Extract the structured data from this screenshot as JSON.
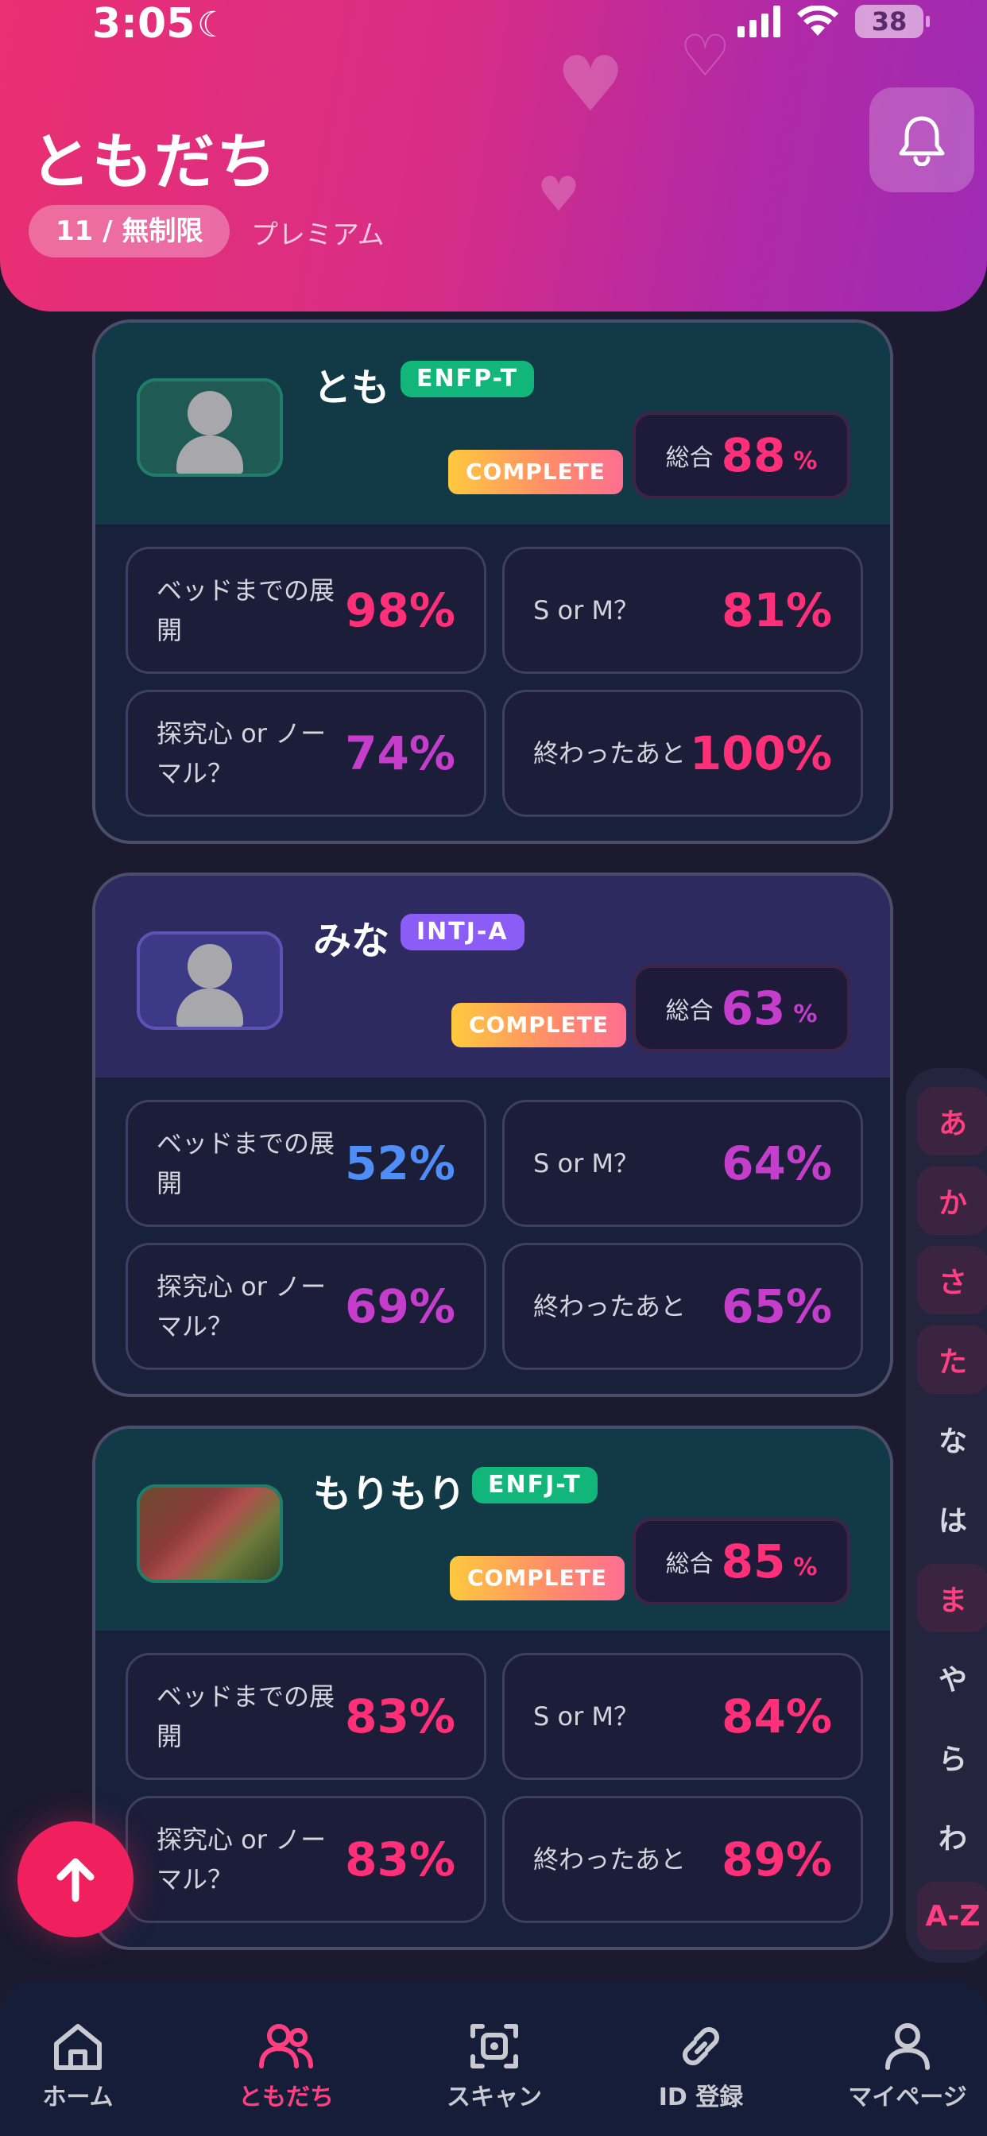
{
  "status_bar": {
    "time": "3:05",
    "battery": "38"
  },
  "header": {
    "title": "ともだち",
    "count": "11 / 無制限",
    "plan": "プレミアム"
  },
  "cards": [
    {
      "name": "とも",
      "mbti": "ENFP-T",
      "badge": "COMPLETE",
      "total_label": "総合",
      "total_value": "88",
      "total_unit": "%",
      "stats": [
        {
          "label": "ベッドまでの展開",
          "value": "98%"
        },
        {
          "label": "S or M？",
          "value": "81%"
        },
        {
          "label": "探究心 or ノーマル？",
          "value": "74%"
        },
        {
          "label": "終わったあと",
          "value": "100%"
        }
      ]
    },
    {
      "name": "みな",
      "mbti": "INTJ-A",
      "badge": "COMPLETE",
      "total_label": "総合",
      "total_value": "63",
      "total_unit": "%",
      "stats": [
        {
          "label": "ベッドまでの展開",
          "value": "52%"
        },
        {
          "label": "S or M？",
          "value": "64%"
        },
        {
          "label": "探究心 or ノーマル？",
          "value": "69%"
        },
        {
          "label": "終わったあと",
          "value": "65%"
        }
      ]
    },
    {
      "name": "もりもり",
      "mbti": "ENFJ-T",
      "badge": "COMPLETE",
      "total_label": "総合",
      "total_value": "85",
      "total_unit": "%",
      "stats": [
        {
          "label": "ベッドまでの展開",
          "value": "83%"
        },
        {
          "label": "S or M？",
          "value": "84%"
        },
        {
          "label": "探究心 or ノーマル？",
          "value": "83%"
        },
        {
          "label": "終わったあと",
          "value": "89%"
        }
      ]
    }
  ],
  "colors": {
    "pink": "#ff2f78",
    "magenta": "#c43ecb",
    "blue": "#4f8ef7",
    "header_start": "#ea2f73",
    "header_end": "#9e2bb4"
  },
  "index_bar": [
    "あ",
    "か",
    "さ",
    "た",
    "な",
    "は",
    "ま",
    "や",
    "ら",
    "わ",
    "A-Z"
  ],
  "tabs": [
    {
      "label": "ホーム",
      "icon": "home-icon"
    },
    {
      "label": "ともだち",
      "icon": "friends-icon"
    },
    {
      "label": "スキャン",
      "icon": "scan-icon"
    },
    {
      "label": "ID 登録",
      "icon": "link-icon"
    },
    {
      "label": "マイページ",
      "icon": "person-icon"
    }
  ]
}
